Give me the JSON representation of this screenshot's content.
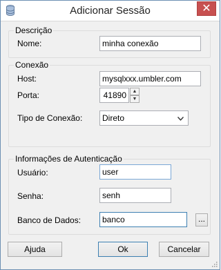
{
  "window": {
    "title": "Adicionar Sessão",
    "close_glyph": "✕"
  },
  "descricao": {
    "group_label": "Descrição",
    "nome_label": "Nome:",
    "nome_value": "minha conexão"
  },
  "conexao": {
    "group_label": "Conexão",
    "host_label": "Host:",
    "host_value": "mysqlxxx.umbler.com",
    "porta_label": "Porta:",
    "porta_value": "41890",
    "tipo_label": "Tipo de Conexão:",
    "tipo_value": "Direto"
  },
  "autenticacao": {
    "group_label": "Informações de Autenticação",
    "usuario_label": "Usuário:",
    "usuario_value": "user",
    "senha_label": "Senha:",
    "senha_value": "senh",
    "banco_label": "Banco de Dados:",
    "banco_value": "banco",
    "browse_label": "..."
  },
  "buttons": {
    "help": "Ajuda",
    "ok": "Ok",
    "cancel": "Cancelar"
  },
  "colors": {
    "accent": "#3c7fb1",
    "close": "#c75050"
  },
  "icons": [
    "database-icon",
    "close-icon",
    "spin-up-icon",
    "spin-down-icon",
    "chevron-down-icon",
    "resize-grip-icon"
  ]
}
